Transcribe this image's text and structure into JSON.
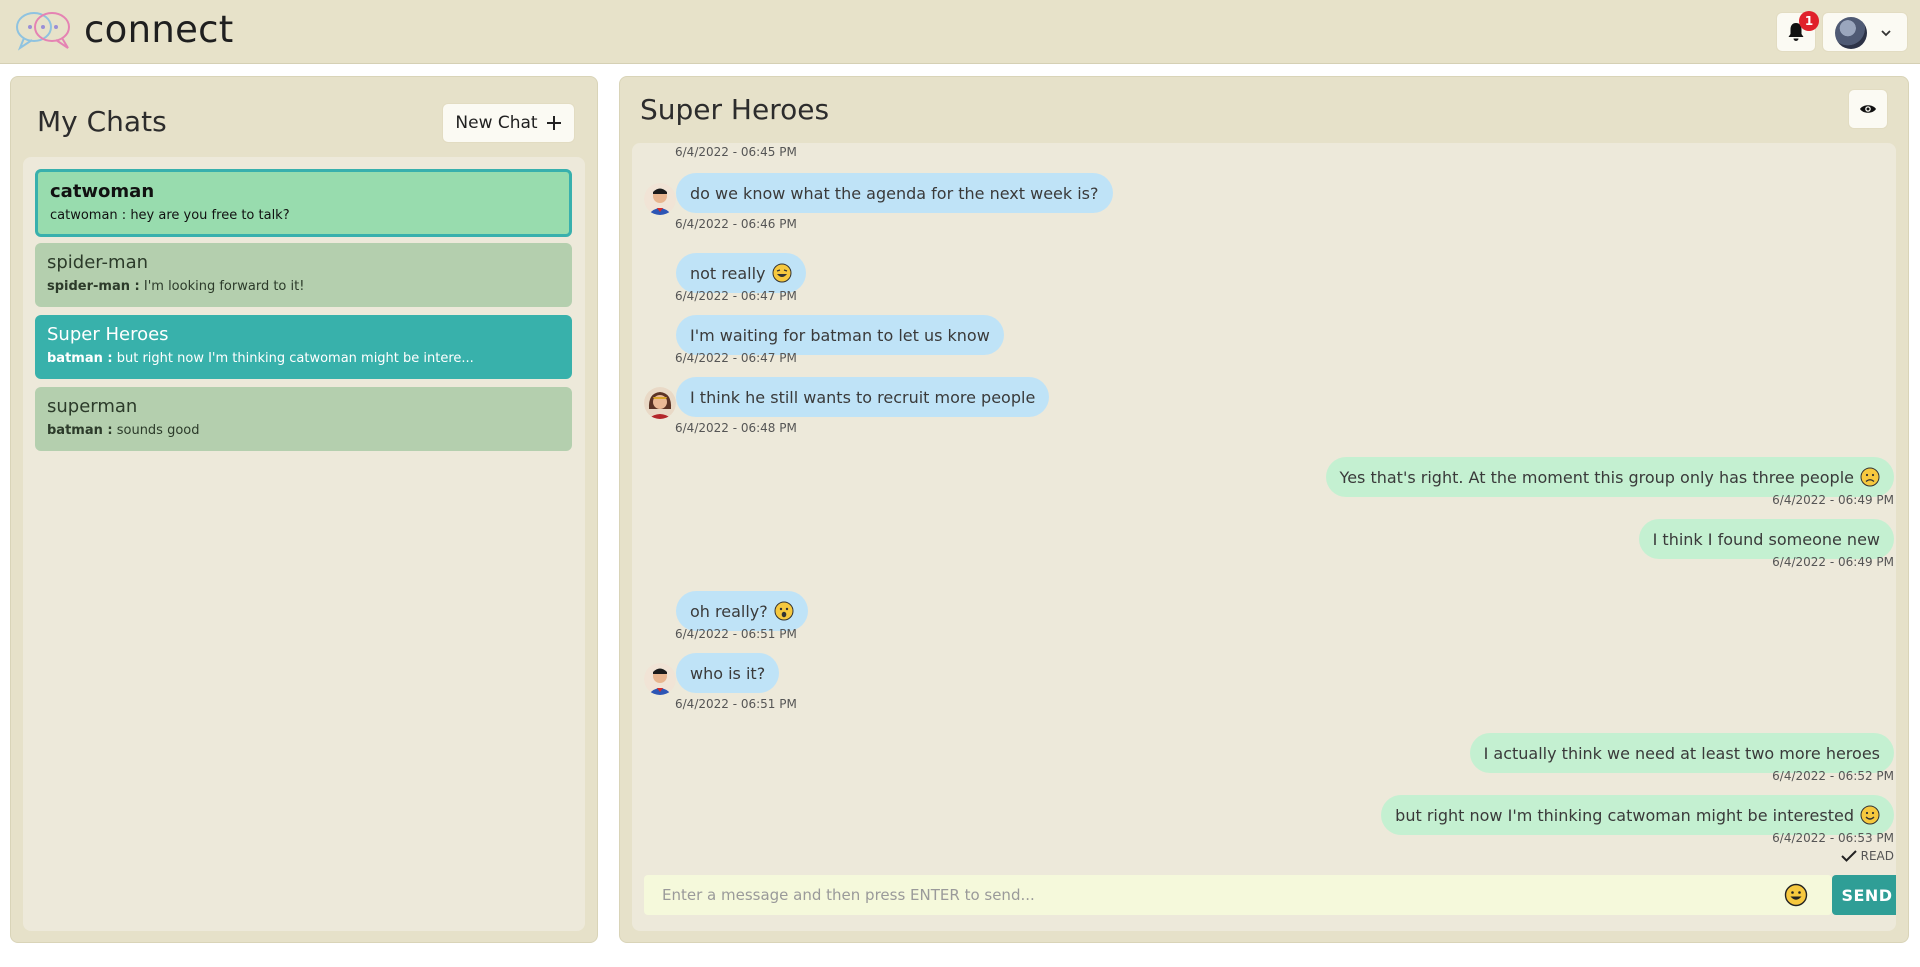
{
  "app": {
    "brand": "connect",
    "notification_count": "1"
  },
  "sidebar": {
    "title": "My Chats",
    "new_chat_label": "New Chat",
    "chats": [
      {
        "name": "catwoman",
        "sender": "catwoman :",
        "preview": " hey are you free to talk?",
        "state": "selected"
      },
      {
        "name": "spider-man",
        "sender": "spider-man :",
        "preview": " I'm looking forward to it!",
        "state": "normal"
      },
      {
        "name": "Super Heroes",
        "sender": "batman :",
        "preview": " but right now I'm thinking catwoman might be intere...",
        "state": "active"
      },
      {
        "name": "superman",
        "sender": "batman :",
        "preview": " sounds good",
        "state": "normal"
      }
    ]
  },
  "conversation": {
    "title": "Super Heroes",
    "top_cut_time": "6/4/2022 - 06:45 PM",
    "messages": [
      {
        "text": "do we know what the agenda for the next week is?",
        "time": "6/4/2022 - 06:46 PM",
        "side": "in"
      },
      {
        "text": "not really",
        "time": "6/4/2022 - 06:47 PM",
        "side": "in",
        "emoji": "grin"
      },
      {
        "text": "I'm waiting for batman to let us know",
        "time": "6/4/2022 - 06:47 PM",
        "side": "in"
      },
      {
        "text": "I think he still wants to recruit more people",
        "time": "6/4/2022 - 06:48 PM",
        "side": "in"
      },
      {
        "text": "Yes that's right. At the moment this group only has three people",
        "time": "6/4/2022 - 06:49 PM",
        "side": "out",
        "emoji": "frown"
      },
      {
        "text": "I think I found someone new",
        "time": "6/4/2022 - 06:49 PM",
        "side": "out"
      },
      {
        "text": "oh really?",
        "time": "6/4/2022 - 06:51 PM",
        "side": "in",
        "emoji": "surprised"
      },
      {
        "text": "who is it?",
        "time": "6/4/2022 - 06:51 PM",
        "side": "in"
      },
      {
        "text": "I actually think we need at least two more heroes",
        "time": "6/4/2022 - 06:52 PM",
        "side": "out"
      },
      {
        "text": "but right now I'm thinking catwoman might be interested",
        "time": "6/4/2022 - 06:53 PM",
        "side": "out",
        "emoji": "smile"
      }
    ],
    "read_label": "READ",
    "composer_placeholder": "Enter a message and then press ENTER to send...",
    "send_label": "SEND"
  },
  "colors": {
    "header_bg": "#e7e2c9",
    "incoming_bubble": "#bfe3f7",
    "outgoing_bubble": "#c4f0d1",
    "active_chat": "#38b1ab",
    "selected_chat": "#98dcae",
    "send_button": "#2f9e96",
    "badge": "#e0202a"
  },
  "icons": [
    "logo-chat-bubbles-icon",
    "bell-icon",
    "chevron-down-icon",
    "plus-icon",
    "eye-icon",
    "emoji-icon",
    "check-icon"
  ]
}
